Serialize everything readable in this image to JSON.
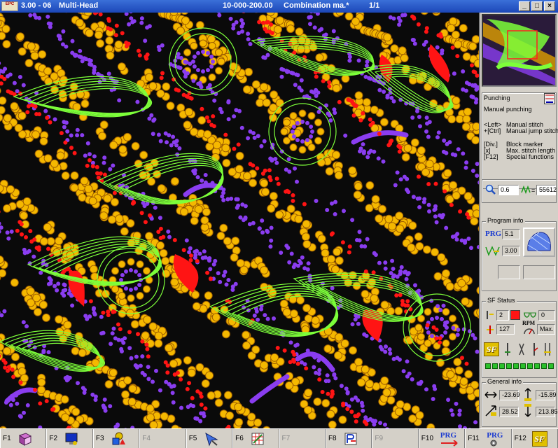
{
  "window": {
    "logo": "EPC",
    "version": "3.00 - 06",
    "mode": "Multi-Head",
    "design": "10-000-200.00",
    "file": "Combination ma.*",
    "page": "1/1",
    "buttons": [
      "_",
      "□",
      "×"
    ]
  },
  "punching": {
    "title": "Punching",
    "mode": "Manual punching",
    "keys": [
      {
        "key": "<Left>",
        "desc": "Manual stitch"
      },
      {
        "key": "+[Ctrl]",
        "desc": "Manual jump stitch"
      },
      {
        "key": "[Div.]",
        "desc": "Block marker"
      },
      {
        "key": "[x]",
        "desc": "Max. stitch length"
      },
      {
        "key": "[F12]",
        "desc": "Special functions"
      }
    ]
  },
  "zoom": {
    "value": "0.6",
    "stitches": "55612"
  },
  "program_info": {
    "title": "Program info",
    "prg_label": "PRG",
    "prg_value": "5.1",
    "stitch_value": "3.00"
  },
  "sf_status": {
    "title": "SF Status",
    "color_value": "2",
    "loop_value": "0",
    "needle_value": "127",
    "rpm_label": "RPM",
    "rpm_value": "Max.",
    "sf_label": "SF",
    "bar_count": 10
  },
  "general_info": {
    "title": "General info",
    "x_left": "-23.69",
    "y_top": "-15.89",
    "diag": "28.52",
    "y_bottom": "213.85"
  },
  "fkeys": [
    {
      "label": "F1",
      "enabled": true,
      "icon": "book-icon"
    },
    {
      "label": "F2",
      "enabled": true,
      "icon": "monitor-icon"
    },
    {
      "label": "F3",
      "enabled": true,
      "icon": "shapes-icon"
    },
    {
      "label": "F4",
      "enabled": false,
      "icon": ""
    },
    {
      "label": "F5",
      "enabled": true,
      "icon": "cursor-icon"
    },
    {
      "label": "F6",
      "enabled": true,
      "icon": "grid-icon"
    },
    {
      "label": "F7",
      "enabled": false,
      "icon": ""
    },
    {
      "label": "F8",
      "enabled": true,
      "icon": "stitch-icon"
    },
    {
      "label": "F9",
      "enabled": false,
      "icon": ""
    },
    {
      "label": "F10",
      "enabled": true,
      "icon": "prg-arrow-icon",
      "text": "PRG"
    },
    {
      "label": "F11",
      "enabled": true,
      "icon": "prg-gear-icon",
      "text": "PRG"
    },
    {
      "label": "F12",
      "enabled": true,
      "icon": "sf-icon",
      "text": "SF"
    }
  ],
  "colors": {
    "canvas": "#0a0a0a",
    "green": "#7dff3a",
    "yellow": "#f5b800",
    "purple": "#8a3df0",
    "red": "#ff1414"
  }
}
